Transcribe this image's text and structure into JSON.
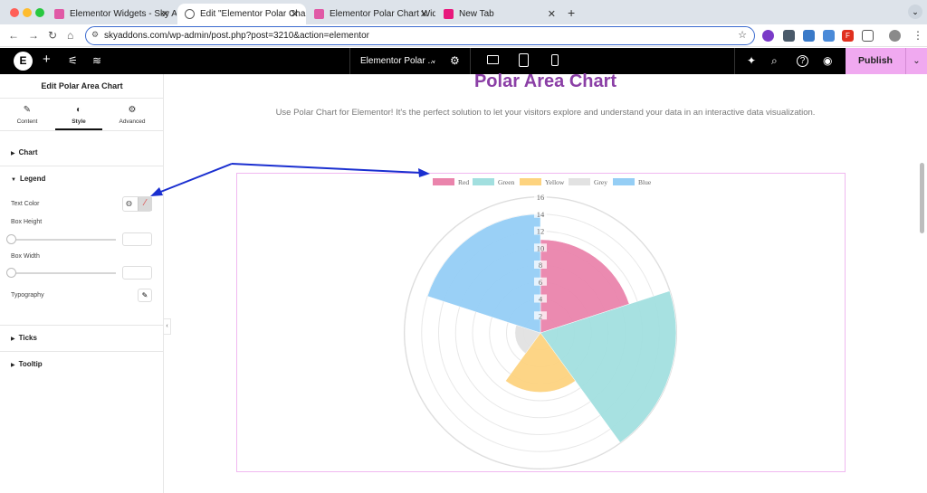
{
  "browser": {
    "tabs": [
      {
        "label": "Elementor Widgets - Sky Add",
        "color": "#e05aa6"
      },
      {
        "label": "Edit \"Elementor Polar Chart W",
        "color": "#5a5a5a"
      },
      {
        "label": "Elementor Polar Chart Widge",
        "color": "#e05aa6"
      },
      {
        "label": "New Tab",
        "color": "#e8197d"
      }
    ],
    "new_tab_icon": "+",
    "url": "skyaddons.com/wp-admin/post.php?post=3210&action=elementor",
    "close_glyph": "✕"
  },
  "elementor": {
    "logo": "E",
    "document_title": "Elementor Polar ...",
    "publish_label": "Publish"
  },
  "panel": {
    "title": "Edit Polar Area Chart",
    "tabs": [
      {
        "label": "Content",
        "icon": "pencil-icon"
      },
      {
        "label": "Style",
        "icon": "contrast-icon"
      },
      {
        "label": "Advanced",
        "icon": "gear-icon"
      }
    ],
    "sections": {
      "chart": "Chart",
      "legend": "Legend",
      "ticks": "Ticks",
      "tooltip": "Tooltip"
    },
    "controls": {
      "text_color": "Text Color",
      "box_height": "Box Height",
      "box_width": "Box Width",
      "typography": "Typography"
    }
  },
  "page": {
    "heading": "Polar Area Chart",
    "subtext": "Use Polar Chart for Elementor! It's the perfect solution to let your visitors explore and understand your data in an interactive data visualization."
  },
  "colors": {
    "accent": "#8b3fa6",
    "publish": "#f0a9f0",
    "arrow": "#1a2fd0"
  },
  "chart_data": {
    "type": "polar-area",
    "categories": [
      "Red",
      "Green",
      "Yellow",
      "Grey",
      "Blue"
    ],
    "values": [
      11,
      16,
      7,
      3,
      14
    ],
    "colors": [
      "#ea84ac",
      "#a2dfdf",
      "#fdd37f",
      "#e2e2e2",
      "#95cef5"
    ],
    "r_ticks": [
      2,
      4,
      6,
      8,
      10,
      12,
      14,
      16
    ],
    "r_max": 16,
    "legend_position": "top",
    "grid": true
  }
}
